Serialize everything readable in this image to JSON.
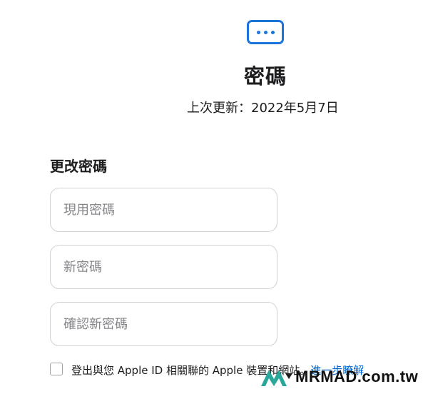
{
  "header": {
    "icon": "password-dots-icon",
    "title": "密碼",
    "updated": "上次更新：2022年5月7日"
  },
  "change_password": {
    "title": "更改密碼",
    "current_password": {
      "placeholder": "現用密碼",
      "value": ""
    },
    "new_password": {
      "placeholder": "新密碼",
      "value": ""
    },
    "confirm_password": {
      "placeholder": "確認新密碼",
      "value": ""
    }
  },
  "sign_out": {
    "checked": false,
    "label": "登出與您 Apple ID 相關聯的 Apple 裝置和網站。",
    "link": "進一步瞭解"
  },
  "watermark": {
    "text": "MRMAD.com.tw"
  },
  "colors": {
    "accent": "#1c74d9",
    "link": "#0066cc",
    "border": "#d2d2d7",
    "placeholder": "#86868b",
    "text": "#1d1d1f",
    "watermark_logo": "#2aa79b"
  }
}
